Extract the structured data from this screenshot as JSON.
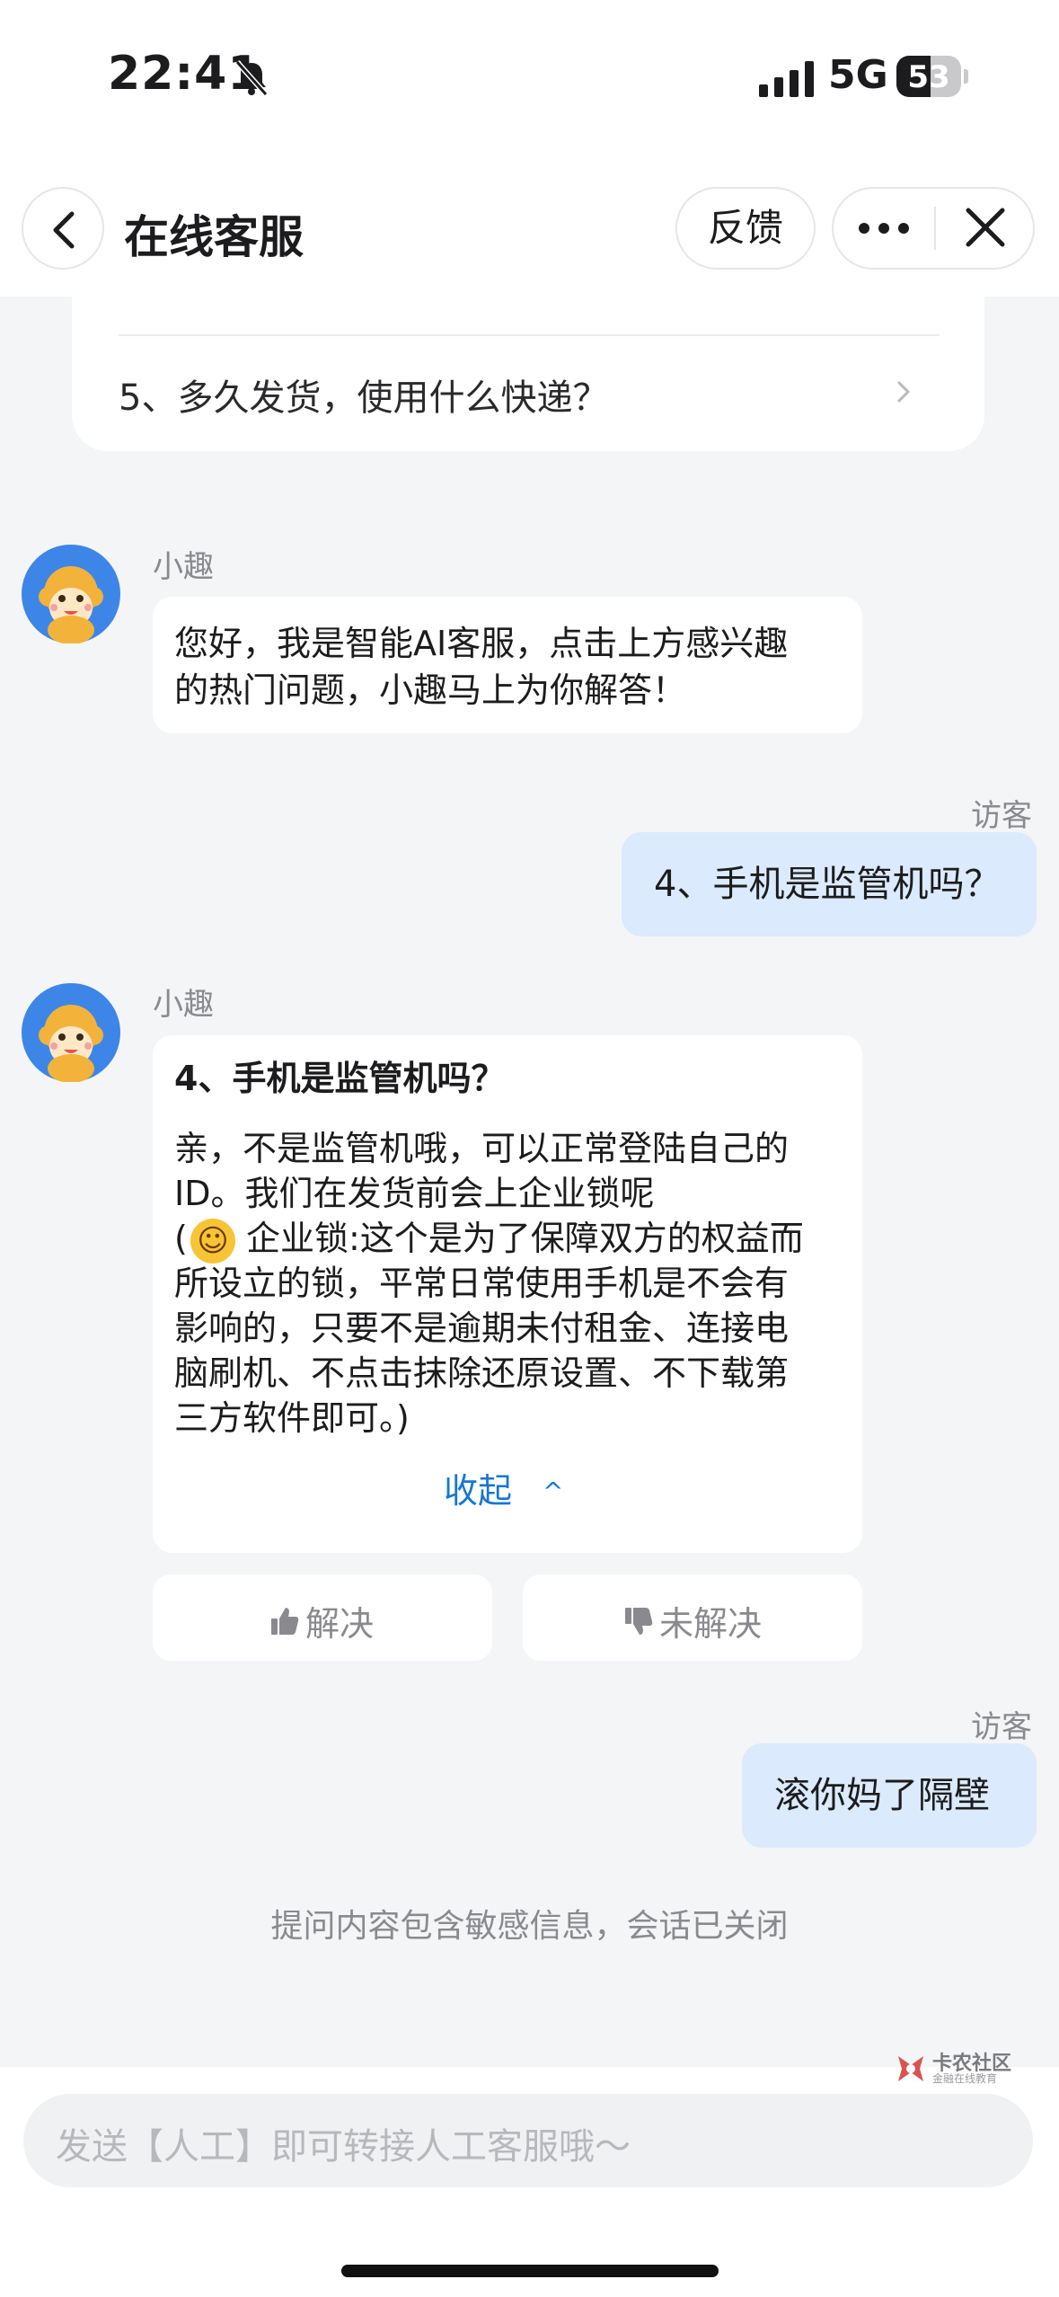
{
  "status_bar": {
    "time": "22:41",
    "network": "5G",
    "battery": "53",
    "battery_level_percent": 53
  },
  "header": {
    "title": "在线客服",
    "feedback_label": "反馈"
  },
  "faq": {
    "question_5": "5、多久发货，使用什么快递？"
  },
  "messages": {
    "bot_name": "小趣",
    "visitor_name": "访客",
    "greeting": [
      "您好，我是智能AI客服，点击上方感兴趣",
      "的热门问题，小趣马上为你解答！"
    ],
    "visitor_q1": "4、手机是监管机吗？",
    "answer_title": "4、手机是监管机吗？",
    "answer_lines": [
      "亲，不是监管机哦，可以正常登陆自己的",
      "ID。我们在发货前会上企业锁呢",
      "企业锁:这个是为了保障双方的权益而",
      "所设立的锁，平常日常使用手机是不会有",
      "影响的，只要不是逾期未付租金、连接电",
      "脑刷机、不点击抹除还原设置、不下载第",
      "三方软件即可。)"
    ],
    "answer_paren_open": "(",
    "answer_emoji": "☺",
    "collapse_label": "收起",
    "collapse_arrow": "^",
    "resolved_label": "解决",
    "unresolved_label": "未解决",
    "visitor_q2": "滚你妈了隔壁",
    "system_note": "提问内容包含敏感信息，会话已关闭"
  },
  "input": {
    "placeholder": "发送【人工】即可转接人工客服哦～"
  },
  "watermark": {
    "line1": "卡农社区",
    "line2": "金融在线教育"
  },
  "colors": {
    "visitor_bubble": "#dbeafc",
    "link_blue": "#1677d2",
    "background": "#f4f5f7"
  }
}
